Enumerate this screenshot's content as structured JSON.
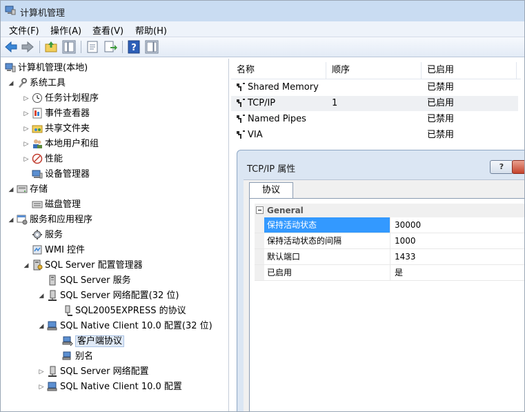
{
  "window": {
    "title": "计算机管理"
  },
  "menu": [
    "文件(F)",
    "操作(A)",
    "查看(V)",
    "帮助(H)"
  ],
  "toolbar": {
    "icons": [
      "back-icon",
      "forward-icon",
      "up-folder-icon",
      "show-hide-tree-icon",
      "properties-icon",
      "export-list-icon",
      "help-icon",
      "show-hide-action-pane-icon"
    ]
  },
  "tree": [
    {
      "label": "计算机管理(本地)",
      "icon": "computer-management-icon"
    },
    {
      "label": "系统工具",
      "icon": "system-tools-icon"
    },
    {
      "label": "任务计划程序",
      "icon": "task-scheduler-icon"
    },
    {
      "label": "事件查看器",
      "icon": "event-viewer-icon"
    },
    {
      "label": "共享文件夹",
      "icon": "shared-folders-icon"
    },
    {
      "label": "本地用户和组",
      "icon": "local-users-icon"
    },
    {
      "label": "性能",
      "icon": "performance-icon"
    },
    {
      "label": "设备管理器",
      "icon": "device-manager-icon"
    },
    {
      "label": "存储",
      "icon": "storage-icon"
    },
    {
      "label": "磁盘管理",
      "icon": "disk-management-icon"
    },
    {
      "label": "服务和应用程序",
      "icon": "services-apps-icon"
    },
    {
      "label": "服务",
      "icon": "services-icon"
    },
    {
      "label": "WMI 控件",
      "icon": "wmi-control-icon"
    },
    {
      "label": "SQL Server 配置管理器",
      "icon": "sql-config-manager-icon"
    },
    {
      "label": "SQL Server 服务",
      "icon": "sql-services-icon"
    },
    {
      "label": "SQL Server 网络配置(32 位)",
      "icon": "sql-network-config-icon"
    },
    {
      "label": "SQL2005EXPRESS 的协议",
      "icon": "protocols-icon"
    },
    {
      "label": "SQL Native Client 10.0 配置(32 位)",
      "icon": "native-client-config-icon"
    },
    {
      "label": "客户端协议",
      "icon": "client-protocols-icon"
    },
    {
      "label": "别名",
      "icon": "aliases-icon"
    },
    {
      "label": "SQL Server 网络配置",
      "icon": "sql-network-config-icon"
    },
    {
      "label": "SQL Native Client 10.0 配置",
      "icon": "native-client-config-icon"
    }
  ],
  "list": {
    "columns": [
      "名称",
      "顺序",
      "已启用"
    ],
    "rows": [
      {
        "name": "Shared Memory",
        "order": "",
        "enabled": "已禁用"
      },
      {
        "name": "TCP/IP",
        "order": "1",
        "enabled": "已启用"
      },
      {
        "name": "Named Pipes",
        "order": "",
        "enabled": "已禁用"
      },
      {
        "name": "VIA",
        "order": "",
        "enabled": "已禁用"
      }
    ]
  },
  "dialog": {
    "title": "TCP/IP 属性",
    "help_label": "?",
    "tab": "协议",
    "category": "General",
    "properties": [
      {
        "name": "保持活动状态",
        "value": "30000"
      },
      {
        "name": "保持活动状态的间隔",
        "value": "1000"
      },
      {
        "name": "默认端口",
        "value": "1433"
      },
      {
        "name": "已启用",
        "value": "是"
      }
    ]
  }
}
